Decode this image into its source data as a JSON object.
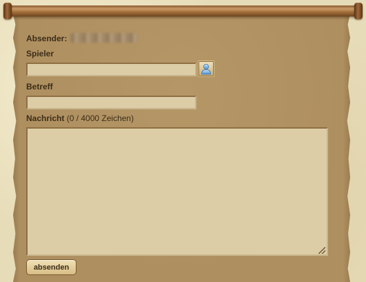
{
  "form": {
    "sender_label": "Absender:",
    "player_label": "Spieler",
    "player_value": "",
    "subject_label": "Betreff",
    "subject_value": "",
    "message_label": "Nachricht",
    "message_counter": "(0 / 4000 Zeichen)",
    "message_value": "",
    "send_label": "absenden"
  },
  "icons": {
    "contact_picker": "person-icon"
  },
  "colors": {
    "panel": "#ae8f60",
    "field_bg": "#dccda7",
    "text": "#3c2d18",
    "rod": "#a8743f"
  }
}
